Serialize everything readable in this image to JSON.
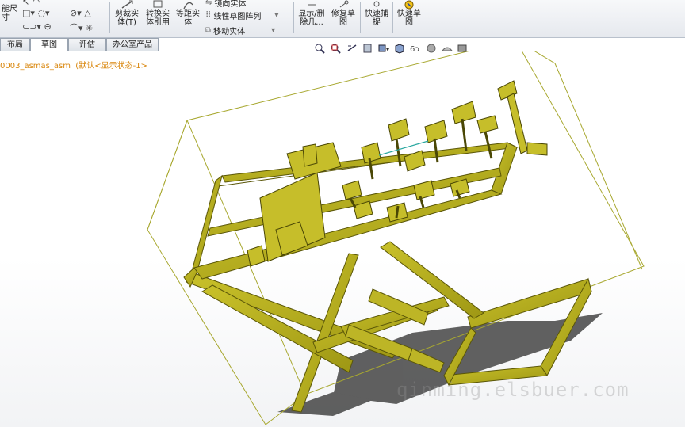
{
  "ribbon": {
    "smart_dimension": "能尺\n寸",
    "trim": "剪裁实\n体(T)",
    "convert": "转换实\n体引用",
    "offset": "等距实\n体",
    "mirror": "镜向实体",
    "linear_pattern": "线性草图阵列",
    "move": "移动实体",
    "show_delete": "显示/删\n除几...",
    "repair": "修复草\n图",
    "quick_snap": "快速捕\n捉",
    "rapid_sketch": "快速草\n图"
  },
  "tabs": [
    {
      "label": "布局"
    },
    {
      "label": "草图"
    },
    {
      "label": "评估"
    },
    {
      "label": "办公室产品"
    }
  ],
  "document": {
    "title": "0003_asmas_asm  (默认<显示状态-1>"
  },
  "watermark": "qinming.elsbuer.com",
  "colors": {
    "model": "#b5ad1c",
    "bbox": "#a8a830",
    "title": "#d9860c"
  }
}
